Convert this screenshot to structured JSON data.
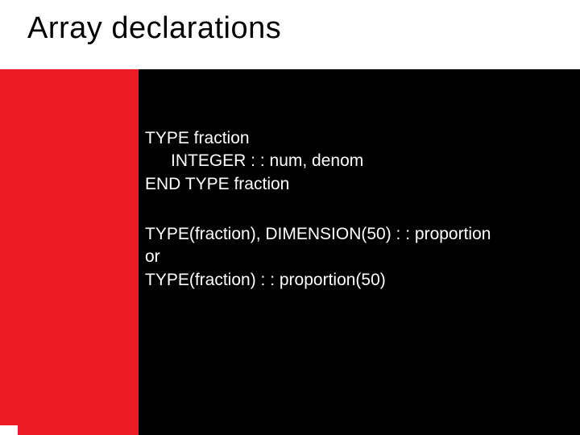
{
  "title": "Array declarations",
  "code": {
    "line1": "TYPE fraction",
    "line2": "INTEGER : : num, denom",
    "line3": "END TYPE fraction",
    "line4": "TYPE(fraction), DIMENSION(50) : : proportion",
    "line5": "or",
    "line6": "TYPE(fraction) : : proportion(50)"
  }
}
